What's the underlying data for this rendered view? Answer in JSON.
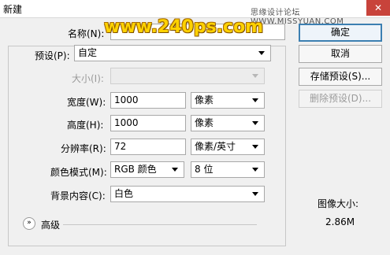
{
  "window": {
    "title": "新建",
    "watermark": "思缘设计论坛 WWW.MISSYUAN.COM",
    "brand_watermark": "www.240ps.com",
    "close_glyph": "✕"
  },
  "form": {
    "name": {
      "label": "名称(N):",
      "value": ""
    },
    "preset": {
      "label": "预设(P):",
      "value": "自定"
    },
    "size": {
      "label": "大小(I):",
      "value": ""
    },
    "width": {
      "label": "宽度(W):",
      "value": "1000",
      "unit": "像素"
    },
    "height": {
      "label": "高度(H):",
      "value": "1000",
      "unit": "像素"
    },
    "resolution": {
      "label": "分辨率(R):",
      "value": "72",
      "unit": "像素/英寸"
    },
    "color_mode": {
      "label": "颜色模式(M):",
      "value": "RGB 颜色",
      "depth": "8 位"
    },
    "background": {
      "label": "背景内容(C):",
      "value": "白色"
    },
    "advanced": {
      "label": "高级",
      "icon": "chevron-double-down-icon"
    }
  },
  "buttons": {
    "ok": "确定",
    "cancel": "取消",
    "save_preset": "存储预设(S)...",
    "delete_preset": "删除预设(D)..."
  },
  "image_size": {
    "label": "图像大小:",
    "value": "2.86M"
  },
  "colors": {
    "accent": "#3c7fb1",
    "close_button": "#c8433b",
    "watermark_yellow": "#ffd200"
  }
}
